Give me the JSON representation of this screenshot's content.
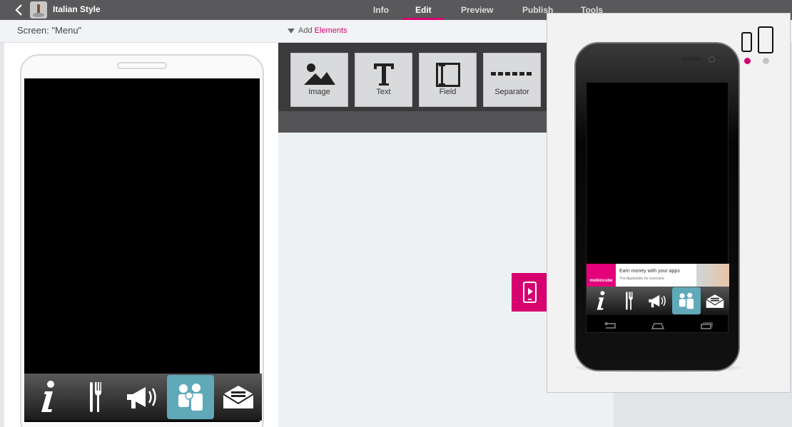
{
  "app": {
    "title": "Italian Style",
    "back_icon": "chevron-left-icon",
    "app_icon": "app-thumbnail-icon"
  },
  "nav": {
    "tabs": [
      {
        "label": "Info"
      },
      {
        "label": "Edit",
        "active": true
      },
      {
        "label": "Preview"
      },
      {
        "label": "Publish"
      },
      {
        "label": "Tools"
      }
    ],
    "accent": "#d6006f"
  },
  "subheader": {
    "screen_label": "Screen: \"Menu\"",
    "add_prefix": "Add",
    "add_highlight": "Elements"
  },
  "elements": [
    {
      "label": "Image",
      "icon": "image-icon"
    },
    {
      "label": "Text",
      "icon": "text-icon"
    },
    {
      "label": "Field",
      "icon": "field-icon"
    },
    {
      "label": "Separator",
      "icon": "separator-icon"
    }
  ],
  "tabbar": [
    {
      "icon": "info-icon"
    },
    {
      "icon": "fork-knife-icon"
    },
    {
      "icon": "megaphone-icon"
    },
    {
      "icon": "people-icon",
      "active": true
    },
    {
      "icon": "envelope-icon"
    }
  ],
  "preview": {
    "ad_brand": "mobincube",
    "ad_title": "Earn money with your apps",
    "ad_subtitle": "The Appbuilder for everyone",
    "device_selected": "phone"
  }
}
